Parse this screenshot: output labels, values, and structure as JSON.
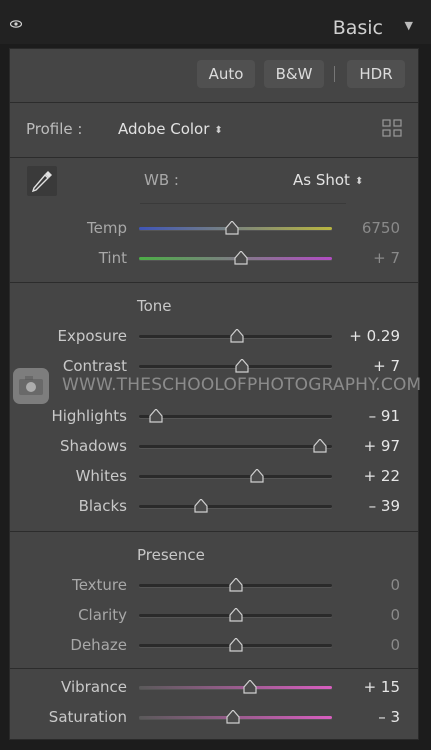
{
  "header": {
    "title": "Basic",
    "collapse_glyph": "▼"
  },
  "treatment_buttons": {
    "auto": "Auto",
    "bw": "B&W",
    "hdr": "HDR"
  },
  "profile": {
    "label": "Profile :",
    "value": "Adobe Color",
    "spinner": "⬍"
  },
  "white_balance": {
    "label": "WB :",
    "value": "As Shot",
    "spinner": "⬍"
  },
  "wb_sliders": [
    {
      "label": "Temp",
      "value": "6750",
      "level": 0.48,
      "dim": true
    },
    {
      "label": "Tint",
      "value": "+ 7",
      "level": 0.53,
      "dim": true
    }
  ],
  "tone": {
    "title": "Tone",
    "sliders": [
      {
        "label": "Exposure",
        "value": "+ 0.29",
        "level": 0.51
      },
      {
        "label": "Contrast",
        "value": "+ 7",
        "level": 0.535
      },
      {
        "label": "Highlights",
        "value": "– 91",
        "level": 0.09
      },
      {
        "label": "Shadows",
        "value": "+ 97",
        "level": 0.94
      },
      {
        "label": "Whites",
        "value": "+ 22",
        "level": 0.61
      },
      {
        "label": "Blacks",
        "value": "– 39",
        "level": 0.32
      }
    ]
  },
  "presence": {
    "title": "Presence",
    "sliders": [
      {
        "label": "Texture",
        "value": "0",
        "level": 0.5,
        "dim": true
      },
      {
        "label": "Clarity",
        "value": "0",
        "level": 0.5,
        "dim": true
      },
      {
        "label": "Dehaze",
        "value": "0",
        "level": 0.5,
        "dim": true
      }
    ]
  },
  "color_sliders": [
    {
      "label": "Vibrance",
      "value": "+ 15",
      "level": 0.575
    },
    {
      "label": "Saturation",
      "value": "– 3",
      "level": 0.485
    }
  ],
  "watermark": {
    "text": "WWW.THESCHOOLOFPHOTOGRAPHY.COM"
  },
  "colors": {
    "panel": "#454545",
    "temp_gradient": [
      "#3f55b8",
      "#b9b640"
    ],
    "tint_gradient": [
      "#4cae46",
      "#b24cc4"
    ],
    "color_gradient": [
      "#5a5a5a",
      "#d85ec0"
    ]
  }
}
